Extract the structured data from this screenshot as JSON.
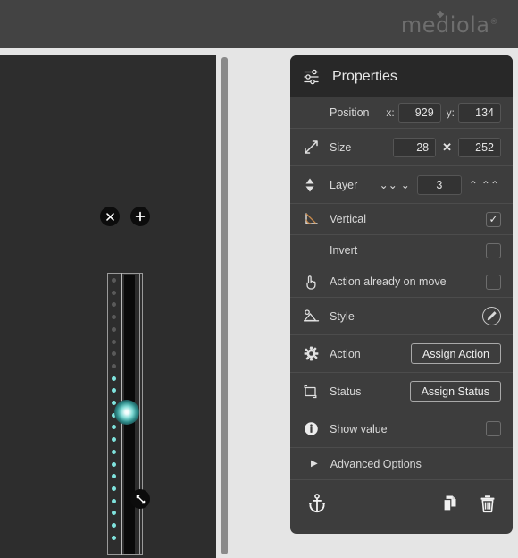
{
  "header": {
    "logo_text": "mediola",
    "logo_registered": "®"
  },
  "panel": {
    "title": "Properties",
    "title_icon": "sliders-icon",
    "rows": {
      "position": {
        "label": "Position",
        "x_label": "x:",
        "y_label": "y:",
        "x_value": "929",
        "y_value": "134"
      },
      "size": {
        "label": "Size",
        "icon": "resize-diagonal-icon",
        "width_value": "28",
        "separator": "✕",
        "height_value": "252"
      },
      "layer": {
        "label": "Layer",
        "icon": "updown-arrow-icon",
        "value": "3",
        "down_all": "⌄⌄",
        "down_one": "⌄",
        "up_one": "⌃",
        "up_all": "⌃⌃"
      },
      "vertical": {
        "label": "Vertical",
        "icon": "angle-arc-icon",
        "checked": true,
        "check_glyph": "✓"
      },
      "invert": {
        "label": "Invert",
        "checked": false
      },
      "action_on_move": {
        "label": "Action already on move",
        "icon": "hand-pointer-icon",
        "checked": false
      },
      "style": {
        "label": "Style",
        "icon": "style-image-icon",
        "button_icon": "pencil-icon"
      },
      "action": {
        "label": "Action",
        "icon": "gear-icon",
        "button_label": "Assign Action"
      },
      "status": {
        "label": "Status",
        "icon": "status-frame-icon",
        "button_label": "Assign Status"
      },
      "show_value": {
        "label": "Show value",
        "icon": "info-icon",
        "checked": false
      },
      "advanced": {
        "label": "Advanced Options",
        "arrow": "▶"
      }
    },
    "footer": {
      "anchor_icon": "anchor-icon",
      "duplicate_icon": "copy-icon",
      "delete_icon": "trash-icon"
    }
  },
  "canvas": {
    "widget": {
      "name": "vertical-slider-widget",
      "close_glyph": "✕",
      "add_glyph": "✛",
      "resize_glyph": "⤡",
      "dot_count": 22,
      "active_dots_from_index": 8,
      "active_color": "#7fe3dd",
      "inactive_color": "#5a5a5a",
      "handle_index": 7
    }
  },
  "colors": {
    "header_bg": "#434343",
    "page_bg": "#e5e5e5",
    "canvas_bg": "#2d2d2d",
    "panel_bg": "#3d3d3d",
    "panel_header_bg": "#282828",
    "accent": "#7fe3dd",
    "text": "#d8d8d8"
  }
}
